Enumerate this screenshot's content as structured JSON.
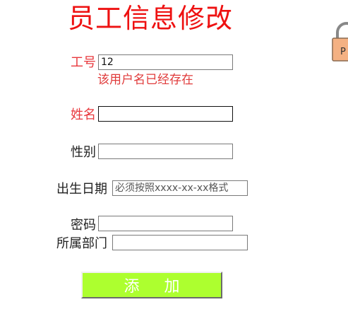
{
  "form": {
    "title": "员工信息修改",
    "fields": {
      "employee_id": {
        "label": "工号",
        "value": "12"
      },
      "name": {
        "label": "姓名",
        "value": ""
      },
      "gender": {
        "label": "性别",
        "value": ""
      },
      "birthdate": {
        "label": "出生日期",
        "value": "",
        "placeholder": "必须按照xxxx-xx-xx格式"
      },
      "password": {
        "label": "密码",
        "value": ""
      },
      "department": {
        "label": "所属部门",
        "value": ""
      }
    },
    "error_message": "该用户名已经存在",
    "submit_label": "添 加"
  },
  "colors": {
    "title": "#ee1111",
    "error_label": "#e8383d",
    "button_bg": "#adff2f",
    "button_text": "#ffffff"
  },
  "side_icon": "padlock-icon"
}
